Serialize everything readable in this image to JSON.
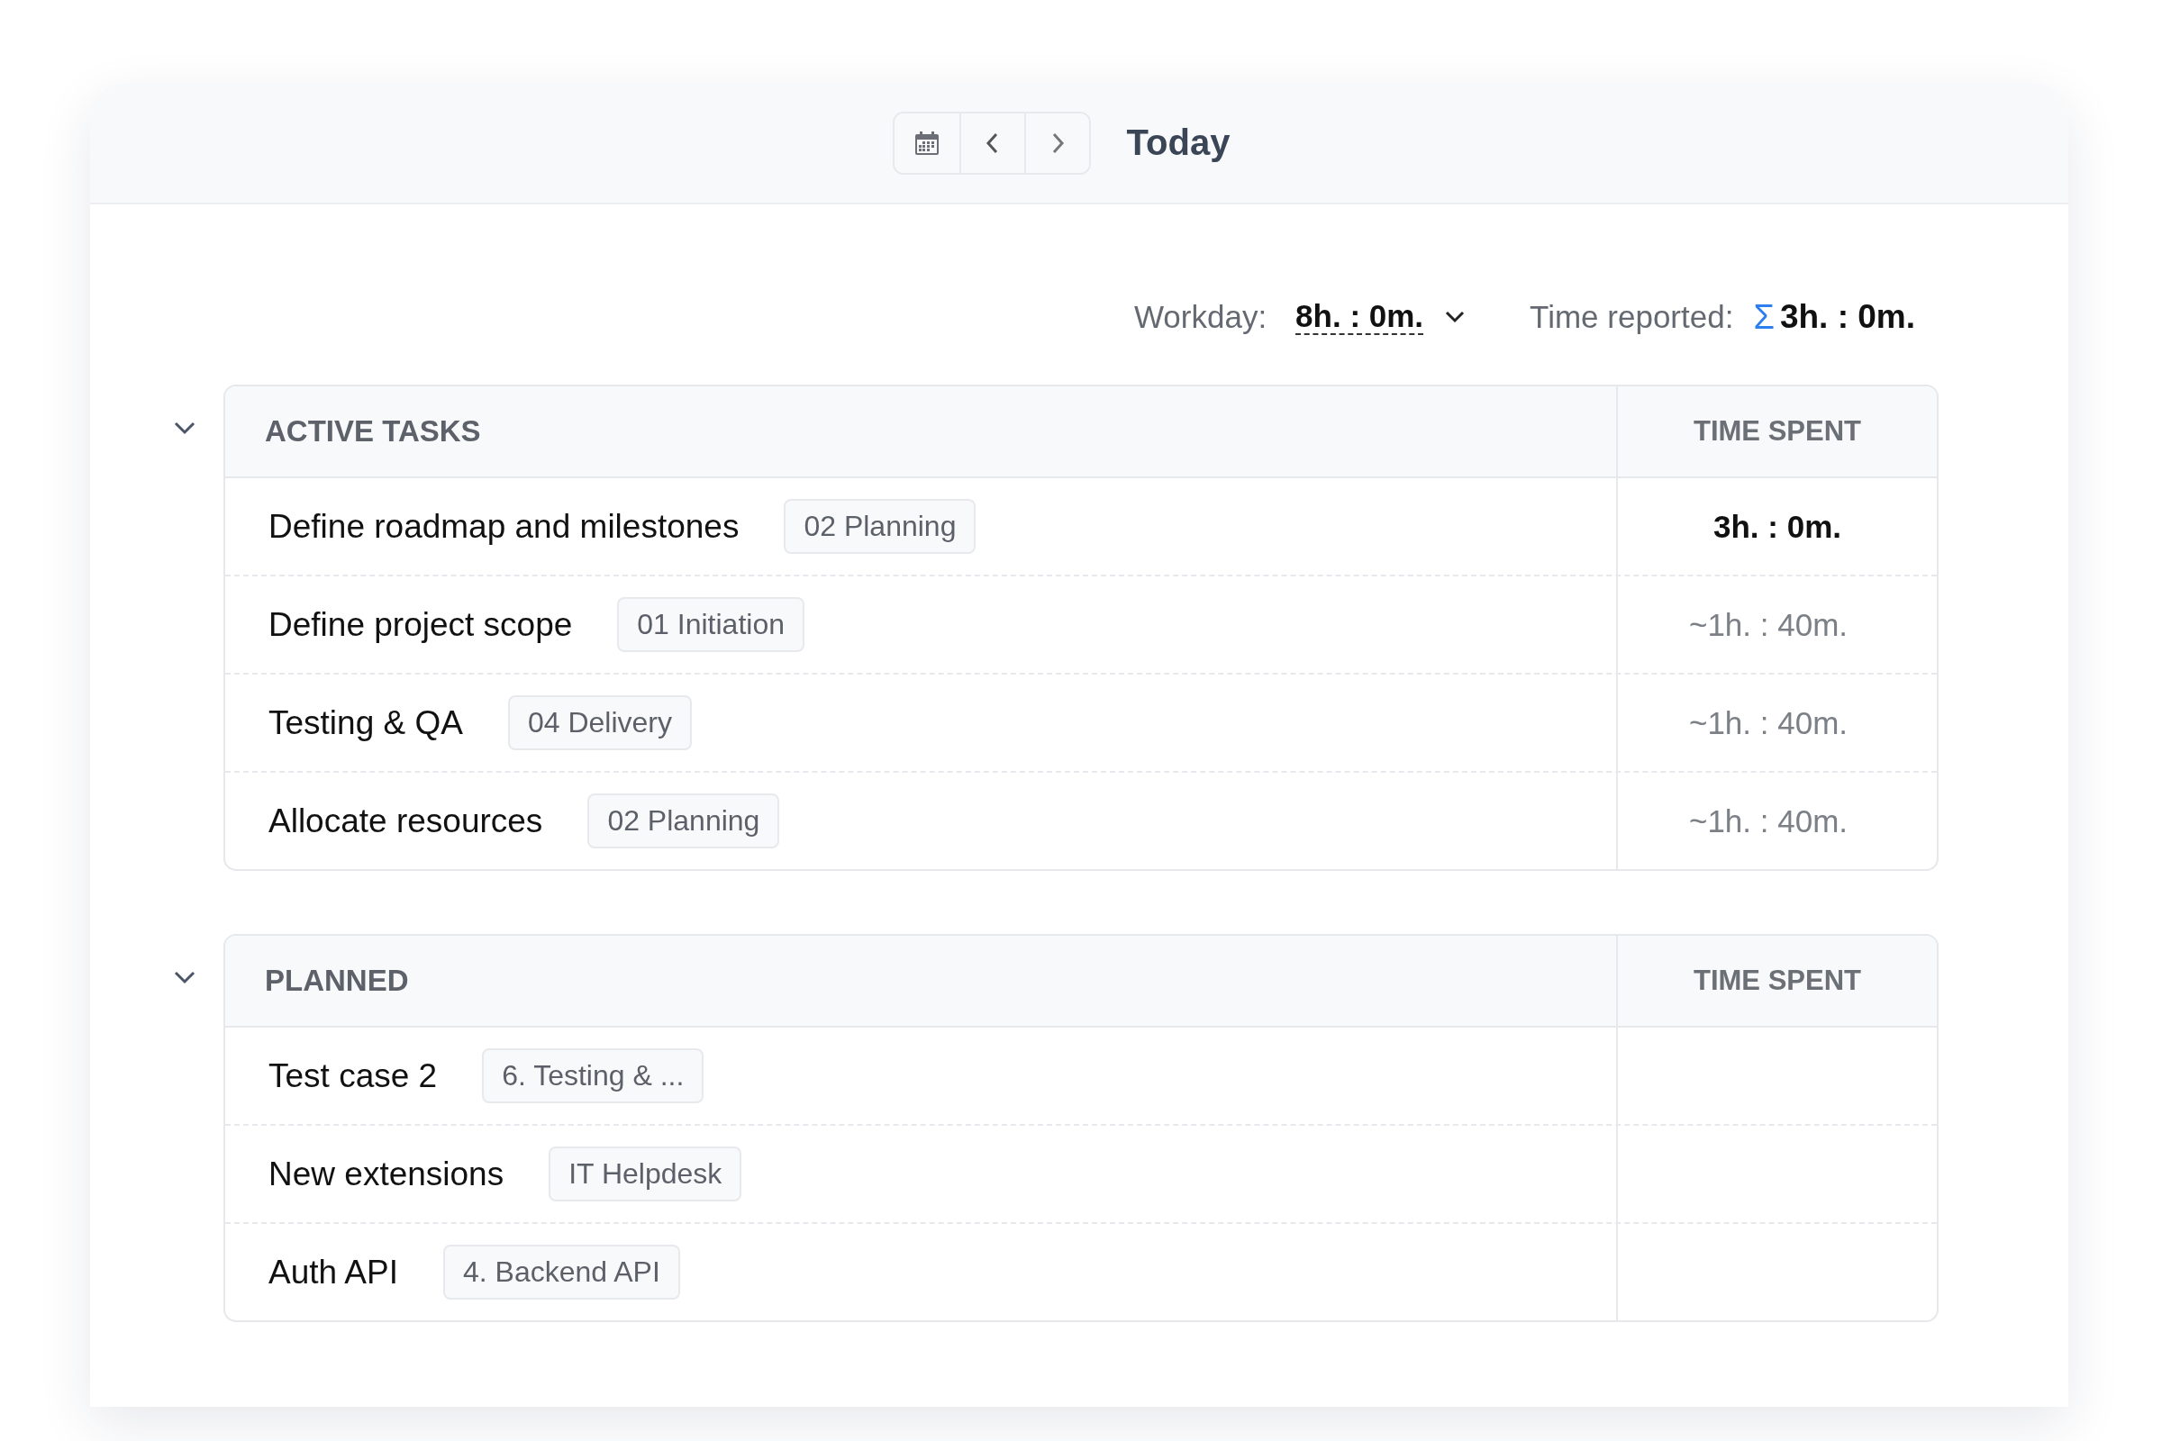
{
  "header": {
    "title": "Today"
  },
  "summary": {
    "workday_label": "Workday:",
    "workday_value": "8h. : 0m.",
    "reported_label": "Time reported:",
    "sigma": "Σ",
    "reported_value": "3h. : 0m."
  },
  "groups": [
    {
      "title": "ACTIVE TASKS",
      "time_heading": "TIME SPENT",
      "expanded": true,
      "rows": [
        {
          "name": "Define roadmap and milestones",
          "tag": "02 Planning",
          "time": "3h. : 0m.",
          "kind": "logged"
        },
        {
          "name": "Define project scope",
          "tag": "01 Initiation",
          "time": "~1h. : 40m.",
          "kind": "estimate"
        },
        {
          "name": "Testing & QA",
          "tag": "04 Delivery",
          "time": "~1h. : 40m.",
          "kind": "estimate"
        },
        {
          "name": "Allocate resources",
          "tag": "02 Planning",
          "time": "~1h. : 40m.",
          "kind": "estimate"
        }
      ]
    },
    {
      "title": "PLANNED",
      "time_heading": "TIME SPENT",
      "expanded": true,
      "rows": [
        {
          "name": "Test case 2",
          "tag": "6. Testing & ...",
          "kind": "empty"
        },
        {
          "name": "New extensions",
          "tag": "IT Helpdesk",
          "kind": "empty"
        },
        {
          "name": "Auth API",
          "tag": "4. Backend API",
          "kind": "empty"
        }
      ]
    }
  ]
}
